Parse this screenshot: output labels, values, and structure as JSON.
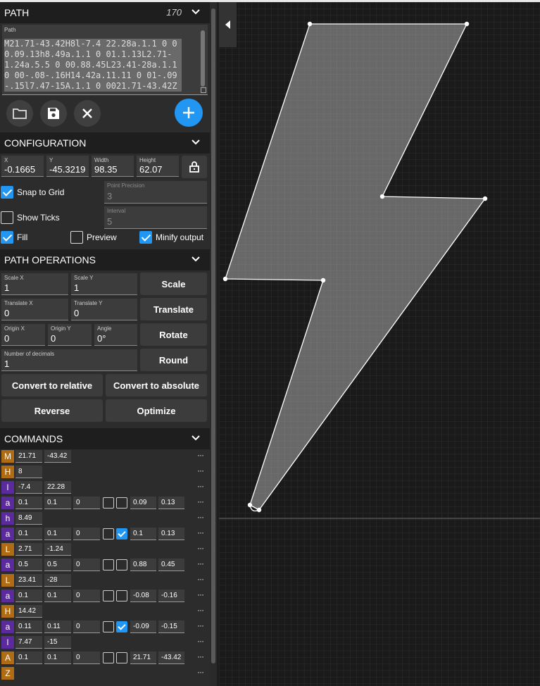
{
  "path_section": {
    "title": "PATH",
    "char_count": "170",
    "textarea_label": "Path",
    "textarea_value": "M21.71-43.42H8l-7.4 22.28a.1.1 0 00.09.13h8.49a.1.1 0 01.1.13L2.71-1.24a.5.5 0 00.88.45L23.41-28a.1.1 0 00-.08-.16H14.42a.11.11 0 01-.09-.15l7.47-15A.1.1 0 0021.71-43.42Z"
  },
  "toolbar": {
    "open_icon": "folder-icon",
    "save_icon": "save-icon",
    "clear_icon": "close-icon",
    "add_icon": "plus-icon"
  },
  "configuration": {
    "title": "CONFIGURATION",
    "x": {
      "label": "X",
      "value": "-0.1665"
    },
    "y": {
      "label": "Y",
      "value": "-45.3219"
    },
    "width": {
      "label": "Width",
      "value": "98.35"
    },
    "height": {
      "label": "Height",
      "value": "62.07"
    },
    "snap_to_grid": {
      "label": "Snap to Grid",
      "checked": true
    },
    "point_precision": {
      "label": "Point Precision",
      "value": "3"
    },
    "show_ticks": {
      "label": "Show Ticks",
      "checked": false
    },
    "interval": {
      "label": "Interval",
      "value": "5"
    },
    "fill": {
      "label": "Fill",
      "checked": true
    },
    "preview": {
      "label": "Preview",
      "checked": false
    },
    "minify": {
      "label": "Minify output",
      "checked": true
    }
  },
  "path_operations": {
    "title": "PATH OPERATIONS",
    "scale_x": {
      "label": "Scale X",
      "value": "1"
    },
    "scale_y": {
      "label": "Scale Y",
      "value": "1"
    },
    "scale_btn": "Scale",
    "translate_x": {
      "label": "Translate X",
      "value": "0"
    },
    "translate_y": {
      "label": "Translate Y",
      "value": "0"
    },
    "translate_btn": "Translate",
    "origin_x": {
      "label": "Origin X",
      "value": "0"
    },
    "origin_y": {
      "label": "Origin Y",
      "value": "0"
    },
    "angle": {
      "label": "Angle",
      "value": "0°"
    },
    "rotate_btn": "Rotate",
    "decimals": {
      "label": "Number of decimals",
      "value": "1"
    },
    "round_btn": "Round",
    "to_relative_btn": "Convert to relative",
    "to_absolute_btn": "Convert to absolute",
    "reverse_btn": "Reverse",
    "optimize_btn": "Optimize"
  },
  "commands": {
    "title": "COMMANDS",
    "more_label": "···",
    "rows": [
      {
        "letter": "M",
        "kind": "abs",
        "values": [
          "21.71",
          "-43.42"
        ]
      },
      {
        "letter": "H",
        "kind": "abs",
        "values": [
          "8"
        ]
      },
      {
        "letter": "l",
        "kind": "rel",
        "values": [
          "-7.4",
          "22.28"
        ]
      },
      {
        "letter": "a",
        "kind": "rel",
        "arc": true,
        "values": [
          "0.1",
          "0.1",
          "0"
        ],
        "large_arc": false,
        "sweep": false,
        "end": [
          "0.09",
          "0.13"
        ]
      },
      {
        "letter": "h",
        "kind": "rel",
        "values": [
          "8.49"
        ]
      },
      {
        "letter": "a",
        "kind": "rel",
        "arc": true,
        "values": [
          "0.1",
          "0.1",
          "0"
        ],
        "large_arc": false,
        "sweep": true,
        "end": [
          "0.1",
          "0.13"
        ]
      },
      {
        "letter": "L",
        "kind": "abs",
        "values": [
          "2.71",
          "-1.24"
        ]
      },
      {
        "letter": "a",
        "kind": "rel",
        "arc": true,
        "values": [
          "0.5",
          "0.5",
          "0"
        ],
        "large_arc": false,
        "sweep": false,
        "end": [
          "0.88",
          "0.45"
        ]
      },
      {
        "letter": "L",
        "kind": "abs",
        "values": [
          "23.41",
          "-28"
        ]
      },
      {
        "letter": "a",
        "kind": "rel",
        "arc": true,
        "values": [
          "0.1",
          "0.1",
          "0"
        ],
        "large_arc": false,
        "sweep": false,
        "end": [
          "-0.08",
          "-0.16"
        ]
      },
      {
        "letter": "H",
        "kind": "abs",
        "values": [
          "14.42"
        ]
      },
      {
        "letter": "a",
        "kind": "rel",
        "arc": true,
        "values": [
          "0.11",
          "0.11",
          "0"
        ],
        "large_arc": false,
        "sweep": true,
        "end": [
          "-0.09",
          "-0.15"
        ]
      },
      {
        "letter": "l",
        "kind": "rel",
        "values": [
          "7.47",
          "-15"
        ]
      },
      {
        "letter": "A",
        "kind": "abs",
        "arc": true,
        "values": [
          "0.1",
          "0.1",
          "0"
        ],
        "large_arc": false,
        "sweep": false,
        "end": [
          "21.71",
          "-43.42"
        ]
      },
      {
        "letter": "Z",
        "kind": "abs",
        "values": []
      }
    ]
  },
  "colors": {
    "accent": "#2196f3",
    "abs_cmd": "#b06b15",
    "rel_cmd": "#5b2a9c",
    "panel": "#2c2c2c"
  }
}
